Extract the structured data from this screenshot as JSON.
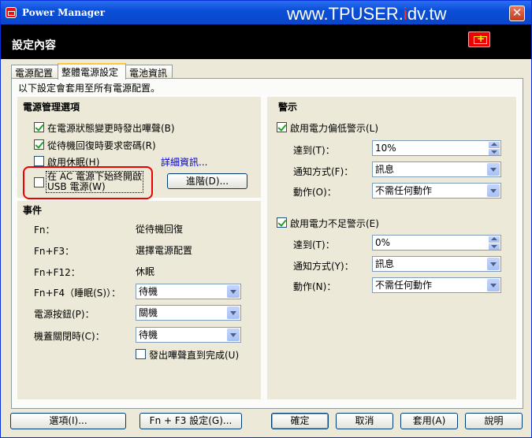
{
  "window": {
    "title": "Power Manager",
    "watermark_pre": "www.TPUSER.",
    "watermark_red": "i",
    "watermark_post": "dv.tw",
    "close": "✕"
  },
  "header": {
    "title": "設定內容"
  },
  "tabs": [
    {
      "label": "電源配置"
    },
    {
      "label": "整體電源設定"
    },
    {
      "label": "電池資訊"
    }
  ],
  "note": "以下設定會套用至所有電源配置。",
  "power_options": {
    "title": "電源管理選項",
    "items": [
      {
        "label": "在電源狀態變更時發出嗶聲(B)",
        "checked": true
      },
      {
        "label": "從待機回復時要求密碼(R)",
        "checked": true
      },
      {
        "label": "啟用休眠(H)",
        "checked": false
      },
      {
        "label": "在 AC 電源下始終開啟",
        "label2": "USB 電源(W)",
        "checked": false
      }
    ],
    "detail_link": "詳細資訊...",
    "advanced_button": "進階(D)..."
  },
  "events": {
    "title": "事件",
    "rows": [
      {
        "key": "Fn：",
        "value": "從待機回復"
      },
      {
        "key": "Fn+F3：",
        "value": "選擇電源配置"
      },
      {
        "key": "Fn+F12：",
        "value": "休眠"
      }
    ],
    "selects": [
      {
        "label": "Fn+F4（睡眠(S)）：",
        "value": "待機"
      },
      {
        "label": "電源按鈕(P)：",
        "value": "關機"
      },
      {
        "label": "機蓋關閉時(C)：",
        "value": "待機"
      }
    ],
    "beep_until_done": {
      "label": "發出嗶聲直到完成(U)",
      "checked": false
    }
  },
  "alarms": {
    "title": "警示",
    "low": {
      "label": "啟用電力偏低警示(L)",
      "checked": true,
      "reach_label": "達到(T)：",
      "reach_value": "10%",
      "notify_label": "通知方式(F)：",
      "notify_value": "訊息",
      "action_label": "動作(O)：",
      "action_value": "不需任何動作"
    },
    "critical": {
      "label": "啟用電力不足警示(E)",
      "checked": true,
      "reach_label": "達到(T)：",
      "reach_value": "0%",
      "notify_label": "通知方式(Y)：",
      "notify_value": "訊息",
      "action_label": "動作(N)：",
      "action_value": "不需任何動作"
    }
  },
  "footer": {
    "options": "選項(I)...",
    "fnf3": "Fn + F3 設定(G)...",
    "ok": "確定",
    "cancel": "取消",
    "apply": "套用(A)",
    "help": "說明"
  }
}
